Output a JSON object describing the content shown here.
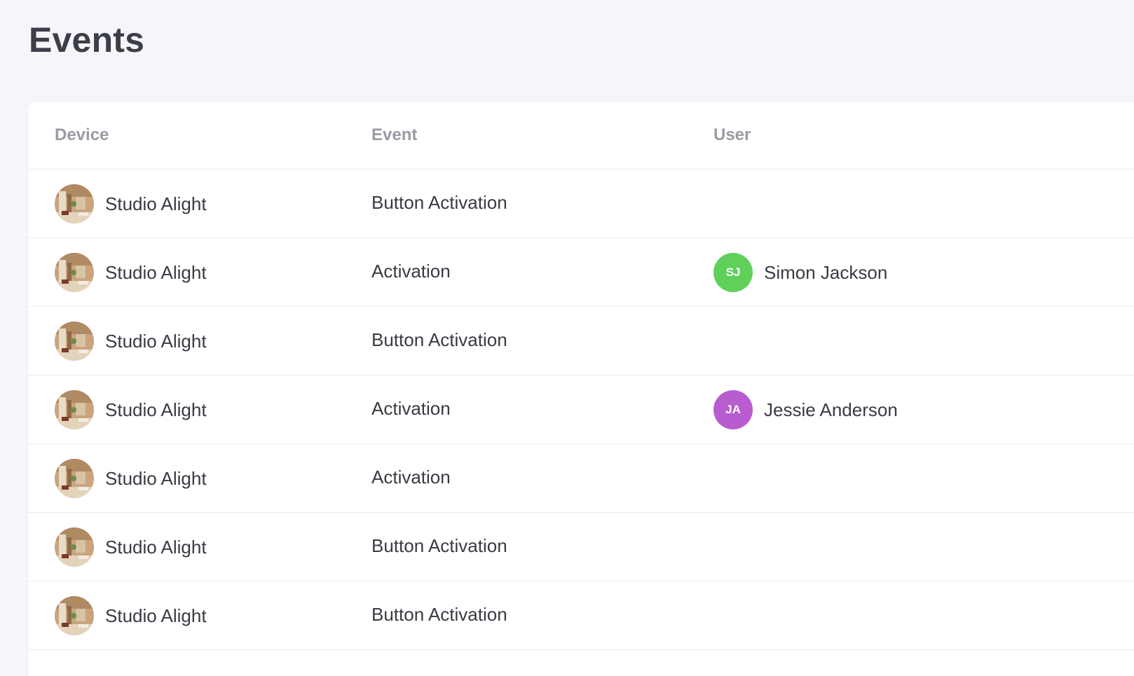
{
  "page": {
    "title": "Events"
  },
  "table": {
    "columns": {
      "device": "Device",
      "event": "Event",
      "user": "User"
    },
    "rows": [
      {
        "device": "Studio Alight",
        "event": "Button Activation",
        "user": null
      },
      {
        "device": "Studio Alight",
        "event": "Activation",
        "user": {
          "initials": "SJ",
          "name": "Simon Jackson",
          "color": "#5fd15a"
        }
      },
      {
        "device": "Studio Alight",
        "event": "Button Activation",
        "user": null
      },
      {
        "device": "Studio Alight",
        "event": "Activation",
        "user": {
          "initials": "JA",
          "name": "Jessie Anderson",
          "color": "#b85ccf"
        }
      },
      {
        "device": "Studio Alight",
        "event": "Activation",
        "user": null
      },
      {
        "device": "Studio Alight",
        "event": "Button Activation",
        "user": null
      },
      {
        "device": "Studio Alight",
        "event": "Button Activation",
        "user": null
      }
    ]
  },
  "icons": {
    "device_thumbnail": "room-photo-icon"
  }
}
